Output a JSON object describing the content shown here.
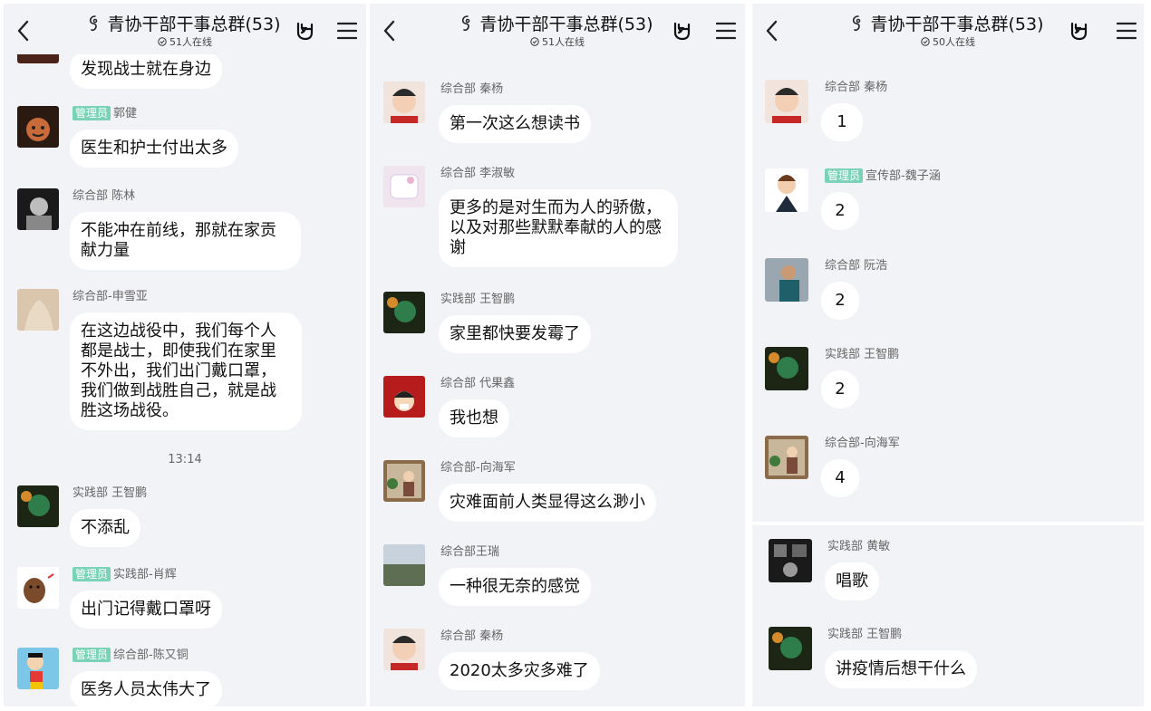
{
  "colors": {
    "panel_bg": "#f2f3f7",
    "bubble_bg": "#ffffff",
    "admin_badge": "#7ad3b6"
  },
  "icons": {
    "back": "chevron-left-icon",
    "title": "chat-group-icon",
    "online": "check-circle-icon",
    "rock": "rock-hand-icon",
    "menu": "hamburger-menu-icon"
  },
  "screens": [
    {
      "header": {
        "title": "青协干部干事总群(53)",
        "online": "51人在线"
      },
      "timestamp": "13:14",
      "messages": [
        {
          "text": "发现战士就在身边"
        },
        {
          "badge": "管理员",
          "sender": "郭健",
          "text": "医生和护士付出太多"
        },
        {
          "sender": "综合部  陈林",
          "text": "不能冲在前线，那就在家贡献力量"
        },
        {
          "sender": "综合部-申雪亚",
          "text": "在这边战役中，我们每个人都是战士，即使我们在家里不外出，我们出门戴口罩，我们做到战胜自己，就是战胜这场战役。"
        },
        {
          "sender": "实践部  王智鹏",
          "text": "不添乱"
        },
        {
          "badge": "管理员",
          "sender": "实践部-肖辉",
          "text": "出门记得戴口罩呀"
        },
        {
          "badge": "管理员",
          "sender": "综合部-陈又铜",
          "text": "医务人员太伟大了"
        }
      ]
    },
    {
      "header": {
        "title": "青协干部干事总群(53)",
        "online": "51人在线"
      },
      "messages": [
        {
          "sender": "综合部  秦杨",
          "text": "第一次这么想读书"
        },
        {
          "sender": "综合部  李淑敏",
          "text": "更多的是对生而为人的骄傲，以及对那些默默奉献的人的感谢"
        },
        {
          "sender": "实践部  王智鹏",
          "text": "家里都快要发霉了"
        },
        {
          "sender": "综合部  代果鑫",
          "text": "我也想"
        },
        {
          "sender": "综合部-向海军",
          "text": "灾难面前人类显得这么渺小"
        },
        {
          "sender": "综合部王瑞",
          "text": "一种很无奈的感觉"
        },
        {
          "sender": "综合部  秦杨",
          "text": "2020太多灾多难了"
        }
      ]
    },
    {
      "header": {
        "title": "青协干部干事总群(53)",
        "online": "50人在线"
      },
      "messages": [
        {
          "sender": "综合部  秦杨",
          "text": "1"
        },
        {
          "badge": "管理员",
          "sender": "宣传部-魏子涵",
          "text": "2"
        },
        {
          "sender": "综合部  阮浩",
          "text": "2"
        },
        {
          "sender": "实践部  王智鹏",
          "text": "2"
        },
        {
          "sender": "综合部-向海军",
          "text": "4"
        },
        {
          "sender": "实践部  黄敏",
          "text": "唱歌"
        },
        {
          "sender": "实践部  王智鹏",
          "text": "讲疫情后想干什么"
        }
      ]
    }
  ]
}
